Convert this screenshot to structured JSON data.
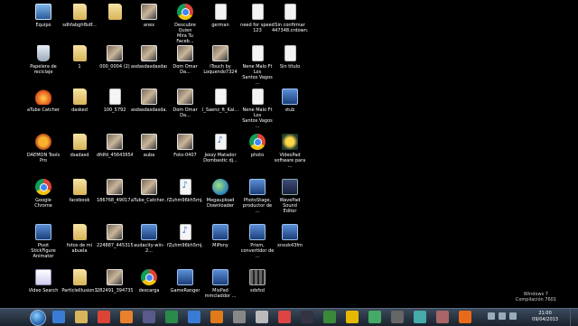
{
  "desktop": {
    "icons": [
      {
        "label": "Equipo",
        "icon": "computer-icon"
      },
      {
        "label": "sdhfabghfbdf...",
        "icon": "folder-icon"
      },
      {
        "label": "",
        "icon": "folder-icon"
      },
      {
        "label": "anex",
        "icon": "photo-icon"
      },
      {
        "label": "Descubre Quien\nMira Tu Faceb...",
        "icon": "chrome-icon"
      },
      {
        "label": "german",
        "icon": "document-icon"
      },
      {
        "label": "need for speed\n123",
        "icon": "document-icon"
      },
      {
        "label": "Sin confirmar\n447348.crdown...",
        "icon": "document-icon"
      },
      {
        "label": "Papelera de\nreciclaje",
        "icon": "recycle-bin-icon"
      },
      {
        "label": "1",
        "icon": "folder-icon"
      },
      {
        "label": "000_0004 (2)",
        "icon": "photo-icon"
      },
      {
        "label": "asdasdasdasdas",
        "icon": "photo-icon"
      },
      {
        "label": "Dom Omar Da...",
        "icon": "photo-icon"
      },
      {
        "label": "iTouch by\nLoquendo7324",
        "icon": "photo-icon"
      },
      {
        "label": "Nene Malo Ft Los\nSantos Vagos ...",
        "icon": "document-icon"
      },
      {
        "label": "Sin título",
        "icon": "document-icon"
      },
      {
        "label": "aTube Catcher",
        "icon": "atube-catcher-icon"
      },
      {
        "label": "dasked",
        "icon": "folder-icon"
      },
      {
        "label": "100_5792",
        "icon": "document-icon"
      },
      {
        "label": "asdasdasdasda...",
        "icon": "photo-icon"
      },
      {
        "label": "Dom Omar Da...",
        "icon": "photo-icon"
      },
      {
        "label": "l_Saenz_ft_Kai...",
        "icon": "document-icon"
      },
      {
        "label": "Nene Malo Ft Los\nSantos Vagos ...",
        "icon": "document-icon"
      },
      {
        "label": "stub",
        "icon": "app-icon"
      },
      {
        "label": "DAEMON Tools\nPro",
        "icon": "daemon-tools-icon"
      },
      {
        "label": "dsadasd",
        "icon": "folder-icon"
      },
      {
        "label": "dfdfd_456436546...",
        "icon": "photo-icon"
      },
      {
        "label": "auba",
        "icon": "photo-icon"
      },
      {
        "label": "Foto-0407",
        "icon": "photo-icon"
      },
      {
        "label": "Jessy Matador\nDombastic dj...",
        "icon": "music-file-icon"
      },
      {
        "label": "photo",
        "icon": "chrome-icon"
      },
      {
        "label": "VideoPad\nsoftware para ...",
        "icon": "videopad-icon"
      },
      {
        "label": "Google Chrome",
        "icon": "chrome-icon"
      },
      {
        "label": "facebook",
        "icon": "folder-icon"
      },
      {
        "label": "186768_49017...",
        "icon": "photo-icon"
      },
      {
        "label": "aTube_Catcher...",
        "icon": "photo-icon"
      },
      {
        "label": "fZuhm96kh5mj...",
        "icon": "music-file-icon"
      },
      {
        "label": "Megaupload\nDownloader",
        "icon": "network-icon"
      },
      {
        "label": "PhotoStage,\nproductor de ...",
        "icon": "app-icon"
      },
      {
        "label": "WavePad Sound\nEditor",
        "icon": "wavepad-icon"
      },
      {
        "label": "Pivot StickFigure\nAnimator",
        "icon": "app-icon"
      },
      {
        "label": "fotos de mi\nabuela",
        "icon": "folder-icon"
      },
      {
        "label": "224887_445315...",
        "icon": "photo-icon"
      },
      {
        "label": "audacity-win-2...",
        "icon": "app-icon"
      },
      {
        "label": "fZuhm96kh5mj...",
        "icon": "music-file-icon"
      },
      {
        "label": "MiPony",
        "icon": "app-icon"
      },
      {
        "label": "Prism,\nconvertidor de ...",
        "icon": "app-icon"
      },
      {
        "label": "xnxxk43fm",
        "icon": "app-icon"
      },
      {
        "label": "Video Search",
        "icon": "video-search-icon"
      },
      {
        "label": "ParticleIllusion3",
        "icon": "folder-icon"
      },
      {
        "label": "282491_39473S...",
        "icon": "photo-icon"
      },
      {
        "label": "descarga",
        "icon": "chrome-icon"
      },
      {
        "label": "GameRanger",
        "icon": "app-icon"
      },
      {
        "label": "MixPad\nmmcladdor ...",
        "icon": "app-icon"
      },
      {
        "label": "sdsfsd",
        "icon": "grid-icon"
      },
      {
        "label": "",
        "icon": "empty"
      }
    ]
  },
  "watermark": {
    "line1": "Windows 7",
    "line2": "Compilación 7601"
  },
  "taskbar": {
    "items": [
      {
        "icon": "ie-icon",
        "color": "#3a7bd5"
      },
      {
        "icon": "explorer-icon",
        "color": "#d8b45a"
      },
      {
        "icon": "chrome-icon",
        "color": "#db4437"
      },
      {
        "icon": "media-player-icon",
        "color": "#e8812c"
      },
      {
        "icon": "video-icon",
        "color": "#5a5a8a"
      },
      {
        "icon": "photo-viewer-icon",
        "color": "#2a8a4a"
      },
      {
        "icon": "gallery-icon",
        "color": "#3a7bd5"
      },
      {
        "icon": "audacity-icon",
        "color": "#e07a1a"
      },
      {
        "icon": "video-search-icon",
        "color": "#888"
      },
      {
        "icon": "keys-icon",
        "color": "#bbb"
      },
      {
        "icon": "paint-icon",
        "color": "#d44"
      },
      {
        "icon": "wavepad-icon",
        "color": "#334"
      },
      {
        "icon": "frog-icon",
        "color": "#3a8a3a"
      },
      {
        "icon": "star-icon",
        "color": "#e6b800"
      },
      {
        "icon": "mixpad-icon",
        "color": "#4a6"
      },
      {
        "icon": "grid-icon",
        "color": "#666"
      },
      {
        "icon": "equalizer-icon",
        "color": "#4aa"
      },
      {
        "icon": "gimp-icon",
        "color": "#a66"
      },
      {
        "icon": "firefox-icon",
        "color": "#e86a1a"
      }
    ],
    "clock": {
      "time": "21:00",
      "date": "09/04/2013"
    }
  }
}
